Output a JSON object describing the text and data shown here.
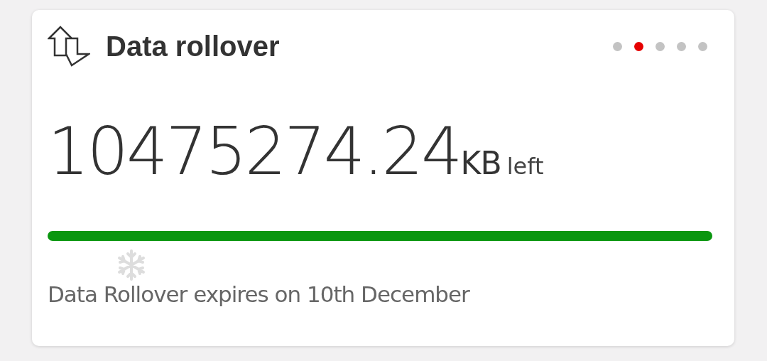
{
  "card": {
    "title": "Data rollover",
    "pages": [
      {
        "selected": false
      },
      {
        "selected": true
      },
      {
        "selected": false
      },
      {
        "selected": false
      },
      {
        "selected": false
      }
    ],
    "amount": "10475274.24",
    "unit": "KB",
    "suffix": "left",
    "expiry": "Data Rollover expires on 10th December"
  }
}
